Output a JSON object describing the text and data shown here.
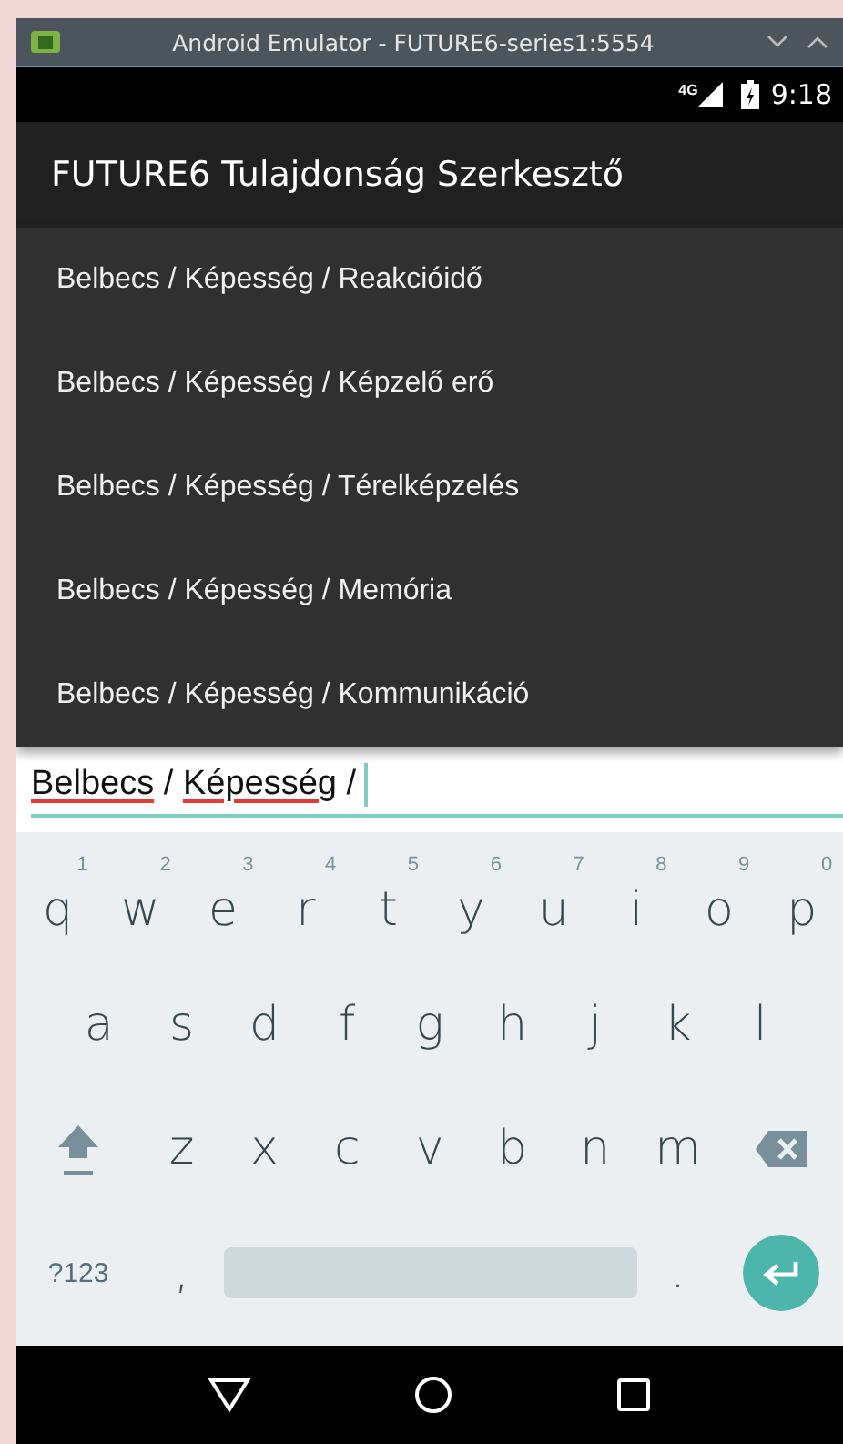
{
  "window": {
    "title": "Android Emulator - FUTURE6-series1:5554"
  },
  "status_bar": {
    "network": "4G",
    "time": "9:18"
  },
  "app_bar": {
    "title": "FUTURE6 Tulajdonság Szerkesztő"
  },
  "suggestions": [
    {
      "label": "Belbecs / Képesség / Reakcióidő"
    },
    {
      "label": "Belbecs / Képesség / Képzelő erő"
    },
    {
      "label": "Belbecs / Képesség / Térelképzelés"
    },
    {
      "label": "Belbecs / Képesség / Memória"
    },
    {
      "label": "Belbecs / Képesség / Kommunikáció"
    }
  ],
  "input": {
    "segments": [
      {
        "text": "Belbecs",
        "misspelled": true
      },
      {
        "text": " / ",
        "misspelled": false
      },
      {
        "text": "Képesség",
        "misspelled": true
      },
      {
        "text": " /",
        "misspelled": false
      }
    ],
    "focused": true
  },
  "keyboard": {
    "rows": [
      {
        "indented": false,
        "keys": [
          {
            "kind": "letter",
            "label": "q",
            "hint": "1"
          },
          {
            "kind": "letter",
            "label": "w",
            "hint": "2"
          },
          {
            "kind": "letter",
            "label": "e",
            "hint": "3"
          },
          {
            "kind": "letter",
            "label": "r",
            "hint": "4"
          },
          {
            "kind": "letter",
            "label": "t",
            "hint": "5"
          },
          {
            "kind": "letter",
            "label": "y",
            "hint": "6"
          },
          {
            "kind": "letter",
            "label": "u",
            "hint": "7"
          },
          {
            "kind": "letter",
            "label": "i",
            "hint": "8"
          },
          {
            "kind": "letter",
            "label": "o",
            "hint": "9"
          },
          {
            "kind": "letter",
            "label": "p",
            "hint": "0"
          }
        ]
      },
      {
        "indented": true,
        "keys": [
          {
            "kind": "letter",
            "label": "a"
          },
          {
            "kind": "letter",
            "label": "s"
          },
          {
            "kind": "letter",
            "label": "d"
          },
          {
            "kind": "letter",
            "label": "f"
          },
          {
            "kind": "letter",
            "label": "g"
          },
          {
            "kind": "letter",
            "label": "h"
          },
          {
            "kind": "letter",
            "label": "j"
          },
          {
            "kind": "letter",
            "label": "k"
          },
          {
            "kind": "letter",
            "label": "l"
          }
        ]
      },
      {
        "indented": false,
        "keys": [
          {
            "kind": "shift"
          },
          {
            "kind": "letter",
            "label": "z"
          },
          {
            "kind": "letter",
            "label": "x"
          },
          {
            "kind": "letter",
            "label": "c"
          },
          {
            "kind": "letter",
            "label": "v"
          },
          {
            "kind": "letter",
            "label": "b"
          },
          {
            "kind": "letter",
            "label": "n"
          },
          {
            "kind": "letter",
            "label": "m"
          },
          {
            "kind": "backspace"
          }
        ]
      },
      {
        "indented": false,
        "keys": [
          {
            "kind": "symbols",
            "label": "?123"
          },
          {
            "kind": "letter",
            "label": ","
          },
          {
            "kind": "space"
          },
          {
            "kind": "letter",
            "label": "."
          },
          {
            "kind": "enter"
          }
        ]
      }
    ]
  }
}
